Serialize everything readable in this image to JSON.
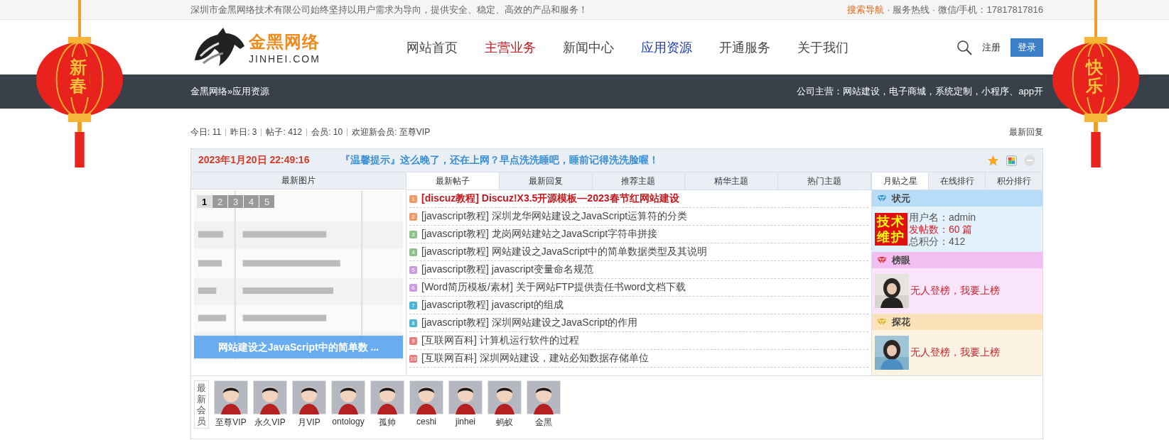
{
  "topbar": {
    "slogan": "深圳市金黑网络技术有限公司始终坚持以用户需求为导向，提供安全、稳定、高效的产品和服务！",
    "search_nav": "搜索导航",
    "hotline": "· 服务热线 · 微信/手机：17817817816"
  },
  "logo": {
    "name": "金黑网络",
    "domain": "JINHEI.COM"
  },
  "nav": [
    {
      "label": "网站首页",
      "selected": false,
      "kind": "normal"
    },
    {
      "label": "主营业务",
      "selected": false,
      "kind": "hot"
    },
    {
      "label": "新闻中心",
      "selected": false,
      "kind": "normal"
    },
    {
      "label": "应用资源",
      "selected": true,
      "kind": "normal"
    },
    {
      "label": "开通服务",
      "selected": false,
      "kind": "normal"
    },
    {
      "label": "关于我们",
      "selected": false,
      "kind": "normal"
    }
  ],
  "register": "注册",
  "login": "登录",
  "breadcrumb": "金黑网络»应用资源",
  "business": "公司主营：网站建设，电子商城，系统定制，小程序、app开",
  "lanterns": [
    {
      "text": "新春"
    },
    {
      "text": "快乐"
    }
  ],
  "stats": [
    "今日: 11",
    "昨日: 3",
    "帖子: 412",
    "会员: 10",
    "欢迎新会员: 至尊VIP"
  ],
  "latest_reply": "最新回复",
  "notice": {
    "time": "2023年1月20日 22:49:16",
    "message": "『温馨提示』这么晚了，还在上网？早点洗洗睡吧，睡前记得洗洗脸喔！"
  },
  "left_tab": "最新图片",
  "tabs": [
    {
      "label": "最新帖子",
      "selected": true
    },
    {
      "label": "最新回复",
      "selected": false
    },
    {
      "label": "推荐主题",
      "selected": false
    },
    {
      "label": "精华主题",
      "selected": false
    },
    {
      "label": "热门主题",
      "selected": false
    }
  ],
  "right_tabs": [
    {
      "label": "月贴之星",
      "selected": true
    },
    {
      "label": "在线排行",
      "selected": false
    },
    {
      "label": "积分排行",
      "selected": false
    }
  ],
  "slideshow": {
    "pages": [
      {
        "label": "1",
        "selected": true
      },
      {
        "label": "2",
        "selected": false
      },
      {
        "label": "3",
        "selected": false
      },
      {
        "label": "4",
        "selected": false
      },
      {
        "label": "5",
        "selected": false
      }
    ],
    "caption": "网站建设之JavaScript中的简单数 ..."
  },
  "posts": [
    {
      "number": "1",
      "text": "[discuz教程] Discuz!X3.5开源模板—2023春节红网站建设",
      "hot": true,
      "color": "#ee9b6b"
    },
    {
      "number": "2",
      "text": "[javascript教程] 深圳龙华网站建设之JavaScript运算符的分类",
      "hot": false,
      "color": "#ee9b6b"
    },
    {
      "number": "3",
      "text": "[javascript教程] 龙岗网站建站之JavaScript字符串拼接",
      "hot": false,
      "color": "#8fc08a"
    },
    {
      "number": "4",
      "text": "[javascript教程] 网站建设之JavaScript中的简单数据类型及其说明",
      "hot": false,
      "color": "#8fc08a"
    },
    {
      "number": "5",
      "text": "[javascript教程] javascript变量命名规范",
      "hot": false,
      "color": "#c99be0"
    },
    {
      "number": "6",
      "text": "[Word简历模板/素材] 关于网站FTP提供责任书word文档下载",
      "hot": false,
      "color": "#c99be0"
    },
    {
      "number": "7",
      "text": "[javascript教程] javascript的组成",
      "hot": false,
      "color": "#4fb3d4"
    },
    {
      "number": "8",
      "text": "[javascript教程] 深圳网站建设之JavaScript的作用",
      "hot": false,
      "color": "#4fb3d4"
    },
    {
      "number": "9",
      "text": "[互联网百科] 计算机运行软件的过程",
      "hot": false,
      "color": "#e87c7c"
    },
    {
      "number": "10",
      "text": "[互联网百科] 深圳网站建设，建站必知数据存储单位",
      "hot": false,
      "color": "#e87c7c"
    }
  ],
  "stars": [
    {
      "title": "状元",
      "kind": "user",
      "color": "#b7dcf7",
      "badge": "技术维护",
      "username": "用户名：admin",
      "posts": "发帖数：60 篇",
      "points": "总积分：412"
    },
    {
      "title": "榜眼",
      "kind": "empty",
      "color": "#f3bff3",
      "message": "无人登榜，我要上榜"
    },
    {
      "title": "探花",
      "kind": "empty",
      "color": "#fbe2b8",
      "message": "无人登榜，我要上榜"
    }
  ],
  "members": {
    "label": "最新会员",
    "list": [
      "至尊VIP",
      "永久VIP",
      "月VIP",
      "ontology",
      "孤帅",
      "ceshi",
      "jinhei",
      "蚂蚁",
      "金黑"
    ]
  }
}
